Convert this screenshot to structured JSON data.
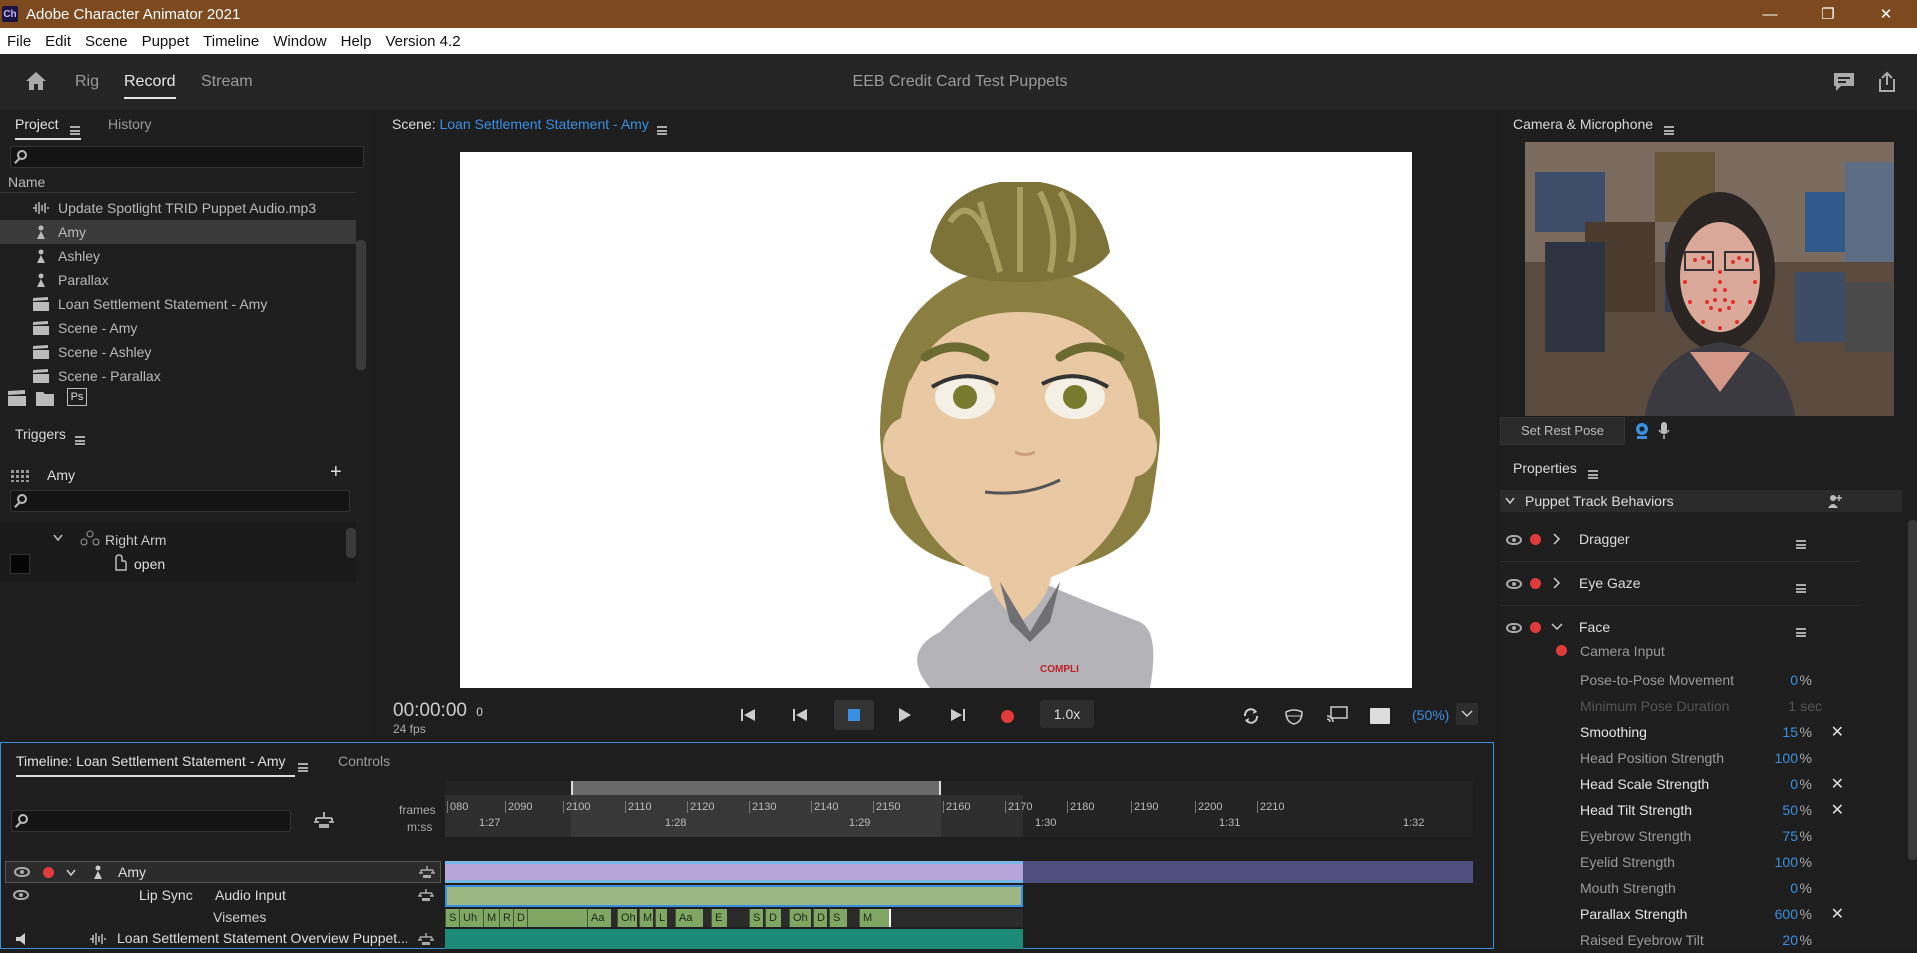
{
  "window": {
    "title": "Adobe Character Animator 2021",
    "app_icon": "Ch",
    "minimize": "—",
    "maximize": "❐",
    "close": "✕"
  },
  "menu": [
    "File",
    "Edit",
    "Scene",
    "Puppet",
    "Timeline",
    "Window",
    "Help",
    "Version 4.2"
  ],
  "nav": {
    "tabs": [
      "Rig",
      "Record",
      "Stream"
    ],
    "active": "Record",
    "project_title": "EEB Credit Card Test Puppets"
  },
  "project_panel": {
    "tabs": [
      "Project",
      "History"
    ],
    "column_header": "Name",
    "items": [
      {
        "icon": "audio-icon",
        "label": "Update Spotlight TRID Puppet Audio.mp3"
      },
      {
        "icon": "puppet-icon",
        "label": "Amy",
        "selected": true
      },
      {
        "icon": "puppet-icon",
        "label": "Ashley"
      },
      {
        "icon": "puppet-icon",
        "label": "Parallax"
      },
      {
        "icon": "scene-icon",
        "label": "Loan Settlement Statement  - Amy"
      },
      {
        "icon": "scene-icon",
        "label": "Scene - Amy"
      },
      {
        "icon": "scene-icon",
        "label": "Scene - Ashley"
      },
      {
        "icon": "scene-icon",
        "label": "Scene - Parallax"
      }
    ],
    "footer_ps": "Ps"
  },
  "triggers_panel": {
    "title": "Triggers",
    "puppet": "Amy",
    "group": "Right Arm",
    "trigger": "open"
  },
  "scene_panel": {
    "label": "Scene:",
    "scene_name": "Loan Settlement Statement  - Amy",
    "timecode": "00:00:00",
    "frame": "0",
    "fps": "24 fps",
    "speed": "1.0x",
    "zoom": "(50%)",
    "shirt_logo": "COMPLI"
  },
  "camera_panel": {
    "title": "Camera & Microphone",
    "rest_pose_button": "Set Rest Pose"
  },
  "properties_panel": {
    "title": "Properties",
    "section": "Puppet Track Behaviors",
    "behaviors": [
      "Dragger",
      "Eye Gaze",
      "Face"
    ],
    "camera_input": "Camera Input",
    "params": [
      {
        "label": "Pose-to-Pose Movement",
        "value": "0",
        "unit": "%",
        "bright": false,
        "x": false,
        "enabled": true
      },
      {
        "label": "Minimum Pose Duration",
        "value": "1",
        "unit": "sec",
        "bright": false,
        "x": false,
        "enabled": false
      },
      {
        "label": "Smoothing",
        "value": "15",
        "unit": "%",
        "bright": true,
        "x": true,
        "enabled": true
      },
      {
        "label": "Head Position Strength",
        "value": "100",
        "unit": "%",
        "bright": false,
        "x": false,
        "enabled": true
      },
      {
        "label": "Head Scale Strength",
        "value": "0",
        "unit": "%",
        "bright": true,
        "x": true,
        "enabled": true
      },
      {
        "label": "Head Tilt Strength",
        "value": "50",
        "unit": "%",
        "bright": true,
        "x": true,
        "enabled": true
      },
      {
        "label": "Eyebrow Strength",
        "value": "75",
        "unit": "%",
        "bright": false,
        "x": false,
        "enabled": true
      },
      {
        "label": "Eyelid Strength",
        "value": "100",
        "unit": "%",
        "bright": false,
        "x": false,
        "enabled": true
      },
      {
        "label": "Mouth Strength",
        "value": "0",
        "unit": "%",
        "bright": false,
        "x": false,
        "enabled": true
      },
      {
        "label": "Parallax Strength",
        "value": "600",
        "unit": "%",
        "bright": true,
        "x": true,
        "enabled": true
      },
      {
        "label": "Raised Eyebrow Tilt",
        "value": "20",
        "unit": "%",
        "bright": false,
        "x": false,
        "enabled": true
      }
    ]
  },
  "timeline": {
    "tab": "Timeline: Loan Settlement Statement  - Amy",
    "controls_tab": "Controls",
    "frames_label": "frames",
    "mss_label": "m:ss",
    "frame_ticks": [
      "080",
      "2090",
      "2100",
      "2110",
      "2120",
      "2130",
      "2140",
      "2150",
      "2160",
      "2170",
      "2180",
      "2190",
      "2200",
      "2210"
    ],
    "time_ticks": [
      "1:27",
      "1:28",
      "1:29",
      "1:30",
      "1:31",
      "1:32"
    ],
    "tracks": {
      "puppet": "Amy",
      "lipsync": "Lip Sync",
      "audio_input": "Audio Input",
      "visemes": "Visemes",
      "audio_track": "Loan Settlement Statement Overview Puppet..."
    },
    "visemes": [
      "S",
      "Uh",
      "M",
      "R",
      "D",
      "Aa",
      "Oh",
      "M",
      "L",
      "Aa",
      "E",
      "S",
      "D",
      "Oh",
      "D",
      "S",
      "M"
    ]
  }
}
